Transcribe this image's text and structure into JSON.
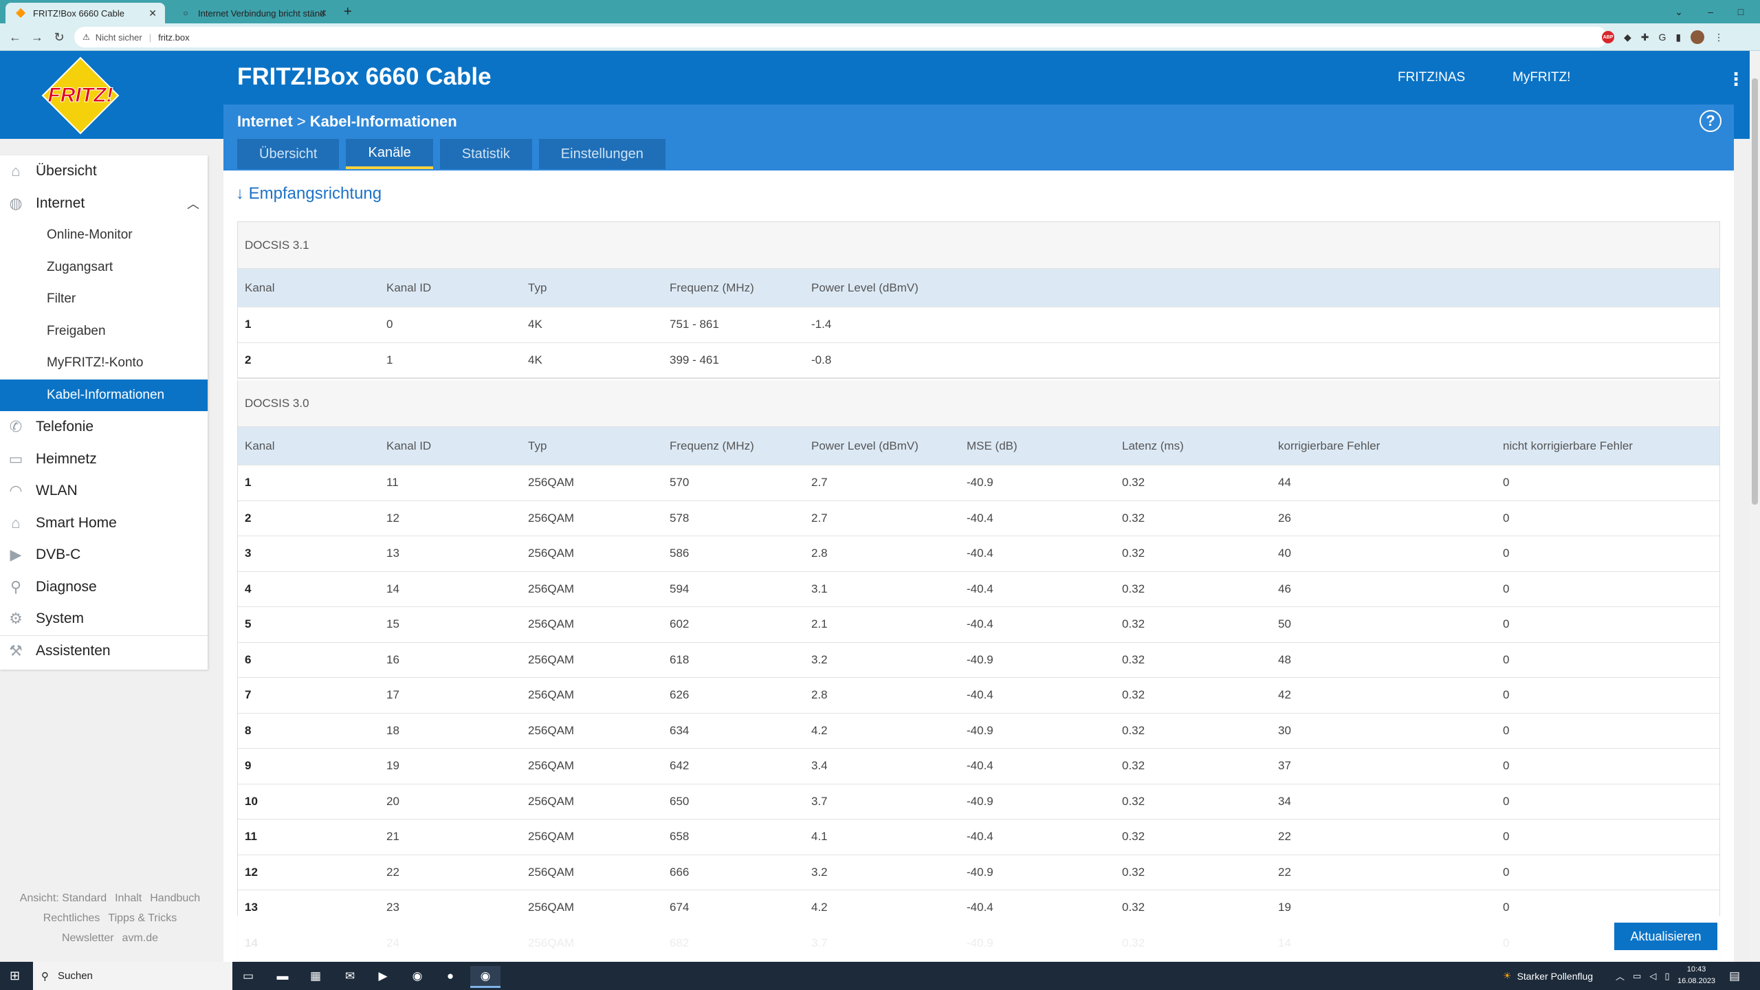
{
  "browser": {
    "tabs": [
      {
        "title": "FRITZ!Box 6660 Cable",
        "active": true
      },
      {
        "title": "Internet Verbindung bricht ständ",
        "active": false
      }
    ],
    "new_tab": "+",
    "window_controls": [
      "–",
      "□",
      "✕"
    ],
    "address": {
      "security": "Nicht sicher",
      "url": "fritz.box"
    }
  },
  "app": {
    "title": "FRITZ!Box 6660 Cable",
    "header_links": [
      "FRITZ!NAS",
      "MyFRITZ!"
    ],
    "logo_text": "FRITZ!",
    "brand_color": "#0a73c6"
  },
  "breadcrumb": {
    "section": "Internet",
    "separator": ">",
    "page": "Kabel-Informationen"
  },
  "tabs": [
    {
      "label": "Übersicht",
      "active": false
    },
    {
      "label": "Kanäle",
      "active": true
    },
    {
      "label": "Statistik",
      "active": false
    },
    {
      "label": "Einstellungen",
      "active": false
    }
  ],
  "sidebar": {
    "items": [
      {
        "label": "Übersicht",
        "icon": "home-icon"
      },
      {
        "label": "Internet",
        "icon": "globe-icon",
        "expanded": true
      },
      {
        "label": "Telefonie",
        "icon": "phone-icon"
      },
      {
        "label": "Heimnetz",
        "icon": "network-icon"
      },
      {
        "label": "WLAN",
        "icon": "wifi-icon"
      },
      {
        "label": "Smart Home",
        "icon": "smarthome-icon"
      },
      {
        "label": "DVB-C",
        "icon": "tv-icon"
      },
      {
        "label": "Diagnose",
        "icon": "diagnose-icon"
      },
      {
        "label": "System",
        "icon": "gear-icon"
      },
      {
        "label": "Assistenten",
        "icon": "wizard-icon"
      }
    ],
    "subitems": [
      {
        "label": "Online-Monitor",
        "active": false
      },
      {
        "label": "Zugangsart",
        "active": false
      },
      {
        "label": "Filter",
        "active": false
      },
      {
        "label": "Freigaben",
        "active": false
      },
      {
        "label": "MyFRITZ!-Konto",
        "active": false
      },
      {
        "label": "Kabel-Informationen",
        "active": true
      }
    ]
  },
  "footer_links": [
    "Ansicht: Standard",
    "Inhalt",
    "Handbuch",
    "Rechtliches",
    "Tipps & Tricks",
    "Newsletter",
    "avm.de"
  ],
  "section_title": "↓ Empfangsrichtung",
  "docsis31": {
    "label": "DOCSIS 3.1",
    "headers": [
      "Kanal",
      "Kanal ID",
      "Typ",
      "Frequenz (MHz)",
      "Power Level (dBmV)"
    ],
    "rows": [
      [
        "1",
        "0",
        "4K",
        "751 - 861",
        "-1.4"
      ],
      [
        "2",
        "1",
        "4K",
        "399 - 461",
        "-0.8"
      ]
    ]
  },
  "docsis30": {
    "label": "DOCSIS 3.0",
    "headers": [
      "Kanal",
      "Kanal ID",
      "Typ",
      "Frequenz (MHz)",
      "Power Level (dBmV)",
      "MSE (dB)",
      "Latenz (ms)",
      "korrigierbare Fehler",
      "nicht korrigierbare Fehler"
    ],
    "rows": [
      [
        "1",
        "11",
        "256QAM",
        "570",
        "2.7",
        "-40.9",
        "0.32",
        "44",
        "0"
      ],
      [
        "2",
        "12",
        "256QAM",
        "578",
        "2.7",
        "-40.4",
        "0.32",
        "26",
        "0"
      ],
      [
        "3",
        "13",
        "256QAM",
        "586",
        "2.8",
        "-40.4",
        "0.32",
        "40",
        "0"
      ],
      [
        "4",
        "14",
        "256QAM",
        "594",
        "3.1",
        "-40.4",
        "0.32",
        "46",
        "0"
      ],
      [
        "5",
        "15",
        "256QAM",
        "602",
        "2.1",
        "-40.4",
        "0.32",
        "50",
        "0"
      ],
      [
        "6",
        "16",
        "256QAM",
        "618",
        "3.2",
        "-40.9",
        "0.32",
        "48",
        "0"
      ],
      [
        "7",
        "17",
        "256QAM",
        "626",
        "2.8",
        "-40.4",
        "0.32",
        "42",
        "0"
      ],
      [
        "8",
        "18",
        "256QAM",
        "634",
        "4.2",
        "-40.9",
        "0.32",
        "30",
        "0"
      ],
      [
        "9",
        "19",
        "256QAM",
        "642",
        "3.4",
        "-40.4",
        "0.32",
        "37",
        "0"
      ],
      [
        "10",
        "20",
        "256QAM",
        "650",
        "3.7",
        "-40.9",
        "0.32",
        "34",
        "0"
      ],
      [
        "11",
        "21",
        "256QAM",
        "658",
        "4.1",
        "-40.4",
        "0.32",
        "22",
        "0"
      ],
      [
        "12",
        "22",
        "256QAM",
        "666",
        "3.2",
        "-40.9",
        "0.32",
        "22",
        "0"
      ],
      [
        "13",
        "23",
        "256QAM",
        "674",
        "4.2",
        "-40.4",
        "0.32",
        "19",
        "0"
      ],
      [
        "14",
        "24",
        "256QAM",
        "682",
        "3.7",
        "-40.9",
        "0.32",
        "14",
        "0"
      ]
    ]
  },
  "update_button": "Aktualisieren",
  "taskbar": {
    "search": "Suchen",
    "weather": "Starker Pollenflug",
    "time": "10:43",
    "date": "16.08.2023"
  }
}
